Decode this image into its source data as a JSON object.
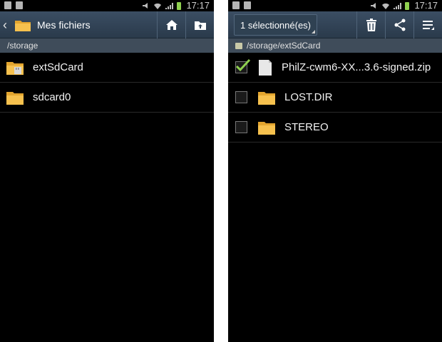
{
  "status_bar": {
    "time": "17:17"
  },
  "left": {
    "title": "Mes fichiers",
    "path": "/storage",
    "items": [
      {
        "label": "extSdCard",
        "icon": "sd-folder-icon"
      },
      {
        "label": "sdcard0",
        "icon": "folder-icon"
      }
    ]
  },
  "right": {
    "selection_label": "1 sélectionné(es)",
    "path": "/storage/extSdCard",
    "items": [
      {
        "label": "PhilZ-cwm6-XX...3.6-signed.zip",
        "checked": true,
        "icon": "zip-file-icon"
      },
      {
        "label": "LOST.DIR",
        "checked": false,
        "icon": "folder-icon"
      },
      {
        "label": "STEREO",
        "checked": false,
        "icon": "folder-icon"
      }
    ]
  },
  "colors": {
    "action_bar": "#34465a",
    "path_bar": "#3f4c5a",
    "folder": "#f2b93b",
    "checkmark": "#8fd14f"
  }
}
